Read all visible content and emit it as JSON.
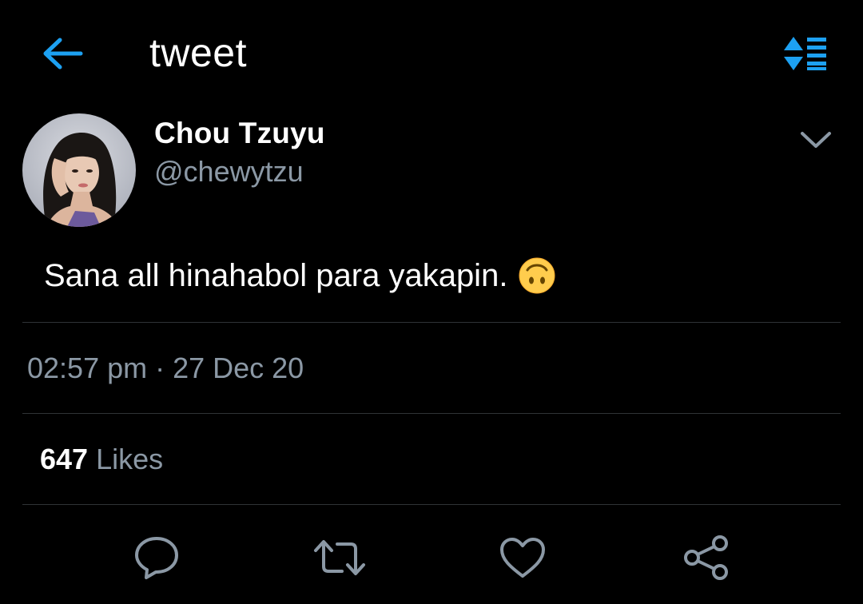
{
  "header": {
    "title": "tweet",
    "back_icon": "arrow-left-icon",
    "sort_icon": "sort-list-icon",
    "accent_color": "#1da1f2"
  },
  "tweet": {
    "author": {
      "display_name": "Chou Tzuyu",
      "handle": "@chewytzu",
      "avatar_icon": "profile-photo"
    },
    "text": "Sana all hinahabol para yakapin.",
    "emoji_icon": "upside-down-face-emoji",
    "timestamp": "02:57 pm · 27 Dec 20",
    "likes": {
      "count": "647",
      "label": "Likes"
    },
    "actions": [
      {
        "icon": "reply-icon"
      },
      {
        "icon": "retweet-icon"
      },
      {
        "icon": "heart-icon"
      },
      {
        "icon": "share-icon"
      }
    ]
  },
  "colors": {
    "background": "#000000",
    "text_primary": "#ffffff",
    "text_secondary": "#8b98a5",
    "divider": "#2f3336",
    "icon_gray": "#8b98a5"
  }
}
